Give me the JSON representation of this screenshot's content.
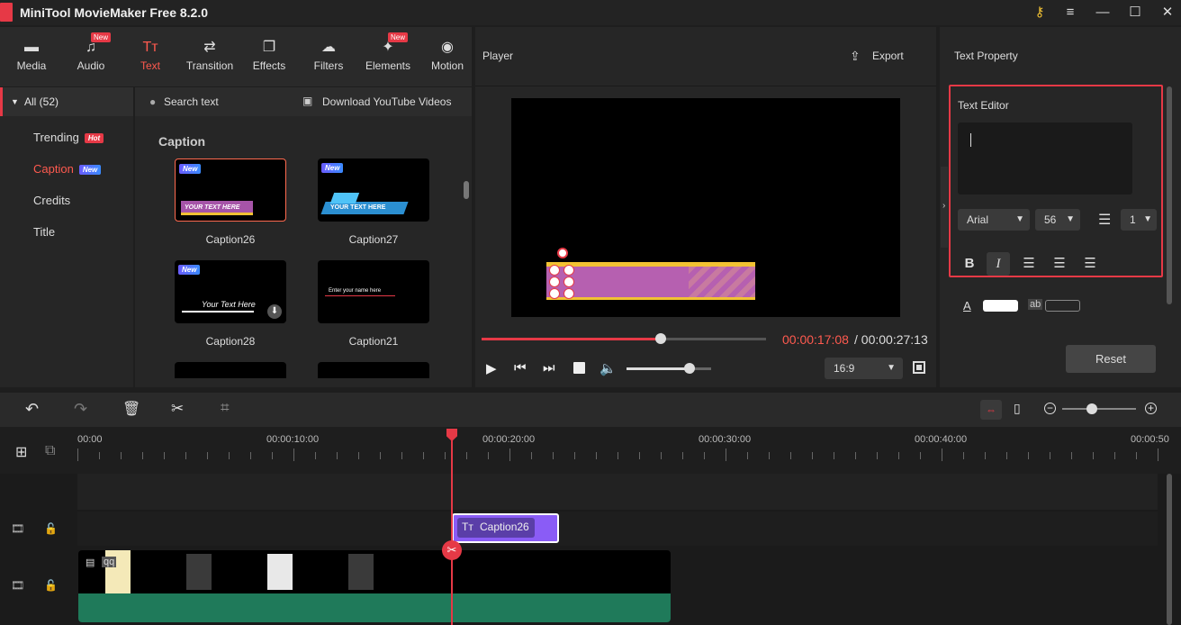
{
  "app": {
    "title": "MiniTool MovieMaker Free 8.2.0"
  },
  "toolbar": {
    "items": [
      {
        "label": "Media",
        "icon": "folder-icon",
        "badge": ""
      },
      {
        "label": "Audio",
        "icon": "music-note-icon",
        "badge": "New"
      },
      {
        "label": "Text",
        "icon": "text-icon",
        "badge": ""
      },
      {
        "label": "Transition",
        "icon": "transition-icon",
        "badge": ""
      },
      {
        "label": "Effects",
        "icon": "effects-icon",
        "badge": ""
      },
      {
        "label": "Filters",
        "icon": "filters-icon",
        "badge": ""
      },
      {
        "label": "Elements",
        "icon": "elements-icon",
        "badge": "New"
      },
      {
        "label": "Motion",
        "icon": "motion-icon",
        "badge": ""
      }
    ],
    "active": "Text"
  },
  "categories": {
    "all": "All (52)",
    "items": [
      {
        "label": "Trending",
        "tag": "Hot"
      },
      {
        "label": "Caption",
        "tag": "New"
      },
      {
        "label": "Credits",
        "tag": ""
      },
      {
        "label": "Title",
        "tag": ""
      }
    ]
  },
  "library": {
    "search_placeholder": "Search text",
    "download_label": "Download YouTube Videos",
    "section": "Caption",
    "items": [
      {
        "name": "Caption26",
        "new": "New",
        "text": "YOUR TEXT HERE"
      },
      {
        "name": "Caption27",
        "new": "New",
        "text": "YOUR TEXT HERE"
      },
      {
        "name": "Caption28",
        "new": "New",
        "text": "Your Text Here"
      },
      {
        "name": "Caption21",
        "new": "",
        "text": "Enter your name here"
      }
    ]
  },
  "player": {
    "label": "Player",
    "export_label": "Export",
    "current_time": "00:00:17:08",
    "total_time": "/ 00:00:27:13",
    "aspect": "16:9",
    "progress": 0.63,
    "volume": 0.74
  },
  "property": {
    "title": "Text Property",
    "editor_label": "Text Editor",
    "font": "Arial",
    "size": "56",
    "line_spacing": "1",
    "reset_label": "Reset",
    "ab": "ab"
  },
  "timeline": {
    "ticks": [
      "00:00",
      "00:00:10:00",
      "00:00:20:00",
      "00:00:30:00",
      "00:00:40:00",
      "00:00:50"
    ],
    "clip_label": "Caption26",
    "video_label": "qq",
    "zoom": 0.4
  },
  "colors": {
    "accent": "#e63946",
    "clip": "#8a5cf6",
    "audio": "#1f7a5a",
    "caption_bar": "#b660b0",
    "caption_edge": "#f2c233"
  }
}
